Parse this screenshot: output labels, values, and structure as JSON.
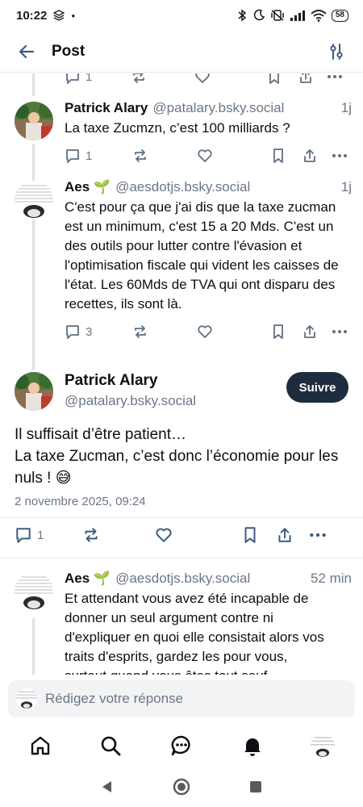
{
  "status_bar": {
    "time": "10:22",
    "battery": "58"
  },
  "header": {
    "title": "Post"
  },
  "top_partial_actions": {
    "reply_count": "1"
  },
  "replies": [
    {
      "name": "Patrick Alary",
      "handle": "@patalary.bsky.social",
      "time": "1j",
      "text": "La taxe Zucmzn, c’est 100 milliards ?",
      "reply_count": "1"
    },
    {
      "name": "Aes 🌱",
      "handle": "@aesdotjs.bsky.social",
      "time": "1j",
      "text": "C'est pour ça que j'ai dis que la taxe zucman est un minimum, c'est 15 a 20 Mds. C'est un des outils pour lutter contre l'évasion et l'optimisation fiscale qui vident les caisses de l'état. Les 60Mds de TVA qui ont disparu des recettes, ils sont là.",
      "reply_count": "3"
    }
  ],
  "main_post": {
    "name": "Patrick Alary",
    "handle": "@patalary.bsky.social",
    "follow_label": "Suivre",
    "body_line1": "Il suffisait d’être patient…",
    "body_line2": "La taxe Zucman, c’est donc l’économie pour les nuls ! 😅",
    "date": "2 novembre 2025, 09:24",
    "reply_count": "1"
  },
  "followup": {
    "name": "Aes 🌱",
    "handle": "@aesdotjs.bsky.social",
    "time": "52 min",
    "text": "Et attendant vous avez été incapable de donner un seul argument contre ni d'expliquer en quoi elle consistait alors vos traits d'esprits, gardez les pour vous, surtout quand vous êtes tout sauf"
  },
  "composer": {
    "placeholder": "Rédigez votre réponse"
  },
  "colors": {
    "accent": "#1e2d3d",
    "muted": "#6b7785",
    "icon": "#5f6f82",
    "divider": "#e6e9ee"
  }
}
